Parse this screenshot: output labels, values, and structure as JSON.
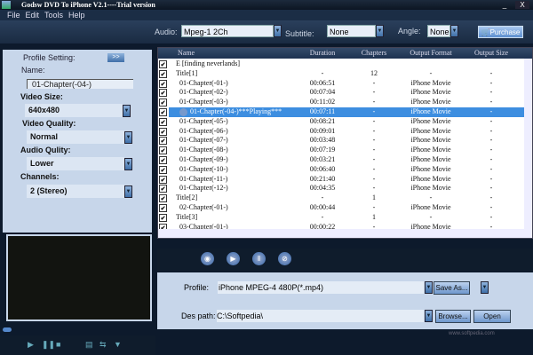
{
  "window": {
    "title": "Godsw DVD To iPhone V2.1----Trial version",
    "minimize": "_",
    "close": "X"
  },
  "menu": [
    "File",
    "Edit",
    "Tools",
    "Help"
  ],
  "toolbar": {
    "audio_label": "Audio:",
    "audio_value": "Mpeg-1 2Ch",
    "subtitle_label": "Subtitle:",
    "subtitle_value": "None",
    "angle_label": "Angle:",
    "angle_value": "None",
    "purchase": "Purchase"
  },
  "profile_setting": {
    "title": "Profile Setting:",
    "expand": ">>",
    "name_label": "Name:",
    "name_value": "01-Chapter(-04-)",
    "video_size_label": "Video Size:",
    "video_size": "640x480",
    "video_quality_label": "Video Quality:",
    "video_quality": "Normal",
    "audio_quality_label": "Audio Qulity:",
    "audio_quality": "Lower",
    "channels_label": "Channels:",
    "channels": "2 (Stereo)"
  },
  "table": {
    "columns": [
      "Name",
      "Duration",
      "Chapters",
      "Output Format",
      "Output Size"
    ],
    "rows": [
      {
        "name": "E  [finding neverlands]",
        "duration": "",
        "chapters": "",
        "format": "",
        "size": "",
        "indent": 0
      },
      {
        "name": "Title[1]",
        "duration": "-",
        "chapters": "12",
        "format": "-",
        "size": "-",
        "indent": 0
      },
      {
        "name": "01-Chapter(-01-)",
        "duration": "00:06:51",
        "chapters": "-",
        "format": "iPhone Movie",
        "size": "-",
        "indent": 1
      },
      {
        "name": "01-Chapter(-02-)",
        "duration": "00:07:04",
        "chapters": "-",
        "format": "iPhone Movie",
        "size": "-",
        "indent": 1
      },
      {
        "name": "01-Chapter(-03-)",
        "duration": "00:11:02",
        "chapters": "-",
        "format": "iPhone Movie",
        "size": "-",
        "indent": 1
      },
      {
        "name": "01-Chapter(-04-)***Playing***",
        "duration": "00:07:11",
        "chapters": "-",
        "format": "iPhone Movie",
        "size": "-",
        "indent": 1,
        "selected": true
      },
      {
        "name": "01-Chapter(-05-)",
        "duration": "00:08:21",
        "chapters": "-",
        "format": "iPhone Movie",
        "size": "-",
        "indent": 1
      },
      {
        "name": "01-Chapter(-06-)",
        "duration": "00:09:01",
        "chapters": "-",
        "format": "iPhone Movie",
        "size": "-",
        "indent": 1
      },
      {
        "name": "01-Chapter(-07-)",
        "duration": "00:03:48",
        "chapters": "-",
        "format": "iPhone Movie",
        "size": "-",
        "indent": 1
      },
      {
        "name": "01-Chapter(-08-)",
        "duration": "00:07:19",
        "chapters": "-",
        "format": "iPhone Movie",
        "size": "-",
        "indent": 1
      },
      {
        "name": "01-Chapter(-09-)",
        "duration": "00:03:21",
        "chapters": "-",
        "format": "iPhone Movie",
        "size": "-",
        "indent": 1
      },
      {
        "name": "01-Chapter(-10-)",
        "duration": "00:06:40",
        "chapters": "-",
        "format": "iPhone Movie",
        "size": "-",
        "indent": 1
      },
      {
        "name": "01-Chapter(-11-)",
        "duration": "00:21:40",
        "chapters": "-",
        "format": "iPhone Movie",
        "size": "-",
        "indent": 1
      },
      {
        "name": "01-Chapter(-12-)",
        "duration": "00:04:35",
        "chapters": "-",
        "format": "iPhone Movie",
        "size": "-",
        "indent": 1
      },
      {
        "name": "Title[2]",
        "duration": "-",
        "chapters": "1",
        "format": "-",
        "size": "-",
        "indent": 0
      },
      {
        "name": "02-Chapter(-01-)",
        "duration": "00:00:44",
        "chapters": "-",
        "format": "iPhone Movie",
        "size": "-",
        "indent": 1
      },
      {
        "name": "Title[3]",
        "duration": "-",
        "chapters": "1",
        "format": "-",
        "size": "-",
        "indent": 0
      },
      {
        "name": "03-Chapter(-01-)",
        "duration": "00:00:22",
        "chapters": "-",
        "format": "iPhone Movie",
        "size": "-",
        "indent": 1
      }
    ]
  },
  "output": {
    "profile_label": "Profile:",
    "profile_value": "iPhone MPEG-4 480P(*.mp4)",
    "save_as": "Save As...",
    "path_label": "Des path:",
    "path_value": "C:\\Softpedia\\",
    "browse": "Browse...",
    "open": "Open"
  },
  "watermark": "www.softpedia.com"
}
